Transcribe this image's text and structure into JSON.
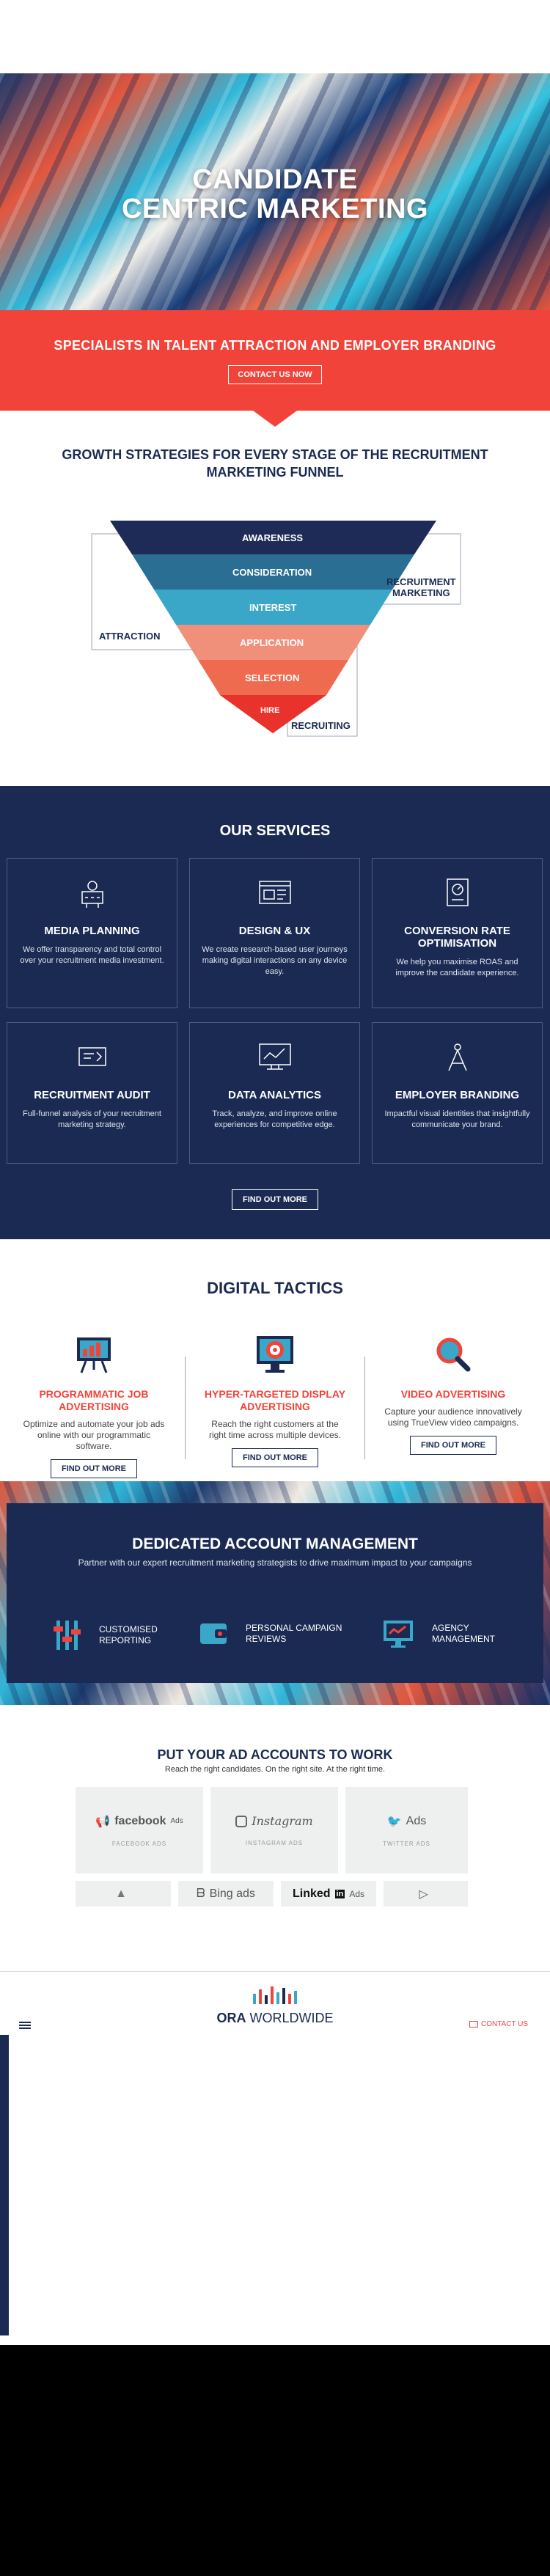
{
  "hero": {
    "title_line1": "CANDIDATE",
    "title_line2": "CENTRIC MARKETING"
  },
  "banner": {
    "headline": "SPECIALISTS IN TALENT ATTRACTION AND EMPLOYER BRANDING",
    "cta": "CONTACT US NOW"
  },
  "funnel": {
    "heading": "GROWTH STRATEGIES FOR EVERY STAGE OF THE RECRUITMENT MARKETING FUNNEL",
    "stages": [
      "AWARENESS",
      "CONSIDERATION",
      "INTEREST",
      "APPLICATION",
      "SELECTION",
      "HIRE"
    ],
    "side_labels": {
      "attraction": "ATTRACTION",
      "recruitment_marketing_1": "RECRUITMENT",
      "recruitment_marketing_2": "MARKETING",
      "recruiting": "RECRUITING"
    },
    "colors": [
      "#1d2b56",
      "#2a6f93",
      "#3aa7c8",
      "#f0907a",
      "#ef6b50",
      "#e8322b"
    ]
  },
  "services": {
    "heading": "OUR SERVICES",
    "items": [
      {
        "title": "MEDIA PLANNING",
        "text": "We offer transparency and total control over your recruitment media investment.",
        "icon": "media-planning-icon"
      },
      {
        "title": "DESIGN & UX",
        "text": "We create research-based user journeys making digital interactions on any device easy.",
        "icon": "design-ux-icon"
      },
      {
        "title": "CONVERSION RATE OPTIMISATION",
        "text": "We help you maximise ROAS and improve the candidate experience.",
        "icon": "conversion-icon"
      },
      {
        "title": "RECRUITMENT AUDIT",
        "text": "Full-funnel analysis of your recruitment marketing strategy.",
        "icon": "audit-icon"
      },
      {
        "title": "DATA ANALYTICS",
        "text": "Track, analyze, and improve online experiences for competitive edge.",
        "icon": "analytics-icon"
      },
      {
        "title": "EMPLOYER BRANDING",
        "text": "Impactful visual identities that insightfully communicate your brand.",
        "icon": "branding-icon"
      }
    ],
    "cta": "FIND OUT MORE"
  },
  "tactics": {
    "heading": "DIGITAL TACTICS",
    "items": [
      {
        "title": "PROGRAMMATIC JOB ADVERTISING",
        "text": "Optimize and automate your job ads online with our programmatic software.",
        "cta": "FIND OUT MORE",
        "icon": "easel-chart-icon"
      },
      {
        "title": "HYPER-TARGETED DISPLAY ADVERTISING",
        "text": "Reach the right customers at the right time across multiple devices.",
        "cta": "FIND OUT MORE",
        "icon": "target-monitor-icon"
      },
      {
        "title": "VIDEO ADVERTISING",
        "text": "Capture your audience innovatively using TrueView video campaigns.",
        "cta": "FIND OUT MORE",
        "icon": "magnifier-icon"
      }
    ]
  },
  "account": {
    "heading": "DEDICATED ACCOUNT MANAGEMENT",
    "subheading": "Partner with our expert recruitment marketing strategists to drive maximum impact to your campaigns",
    "features": [
      {
        "line1": "CUSTOMISED",
        "line2": "REPORTING",
        "icon": "sliders-icon"
      },
      {
        "line1": "PERSONAL CAMPAIGN",
        "line2": "REVIEWS",
        "icon": "wallet-icon"
      },
      {
        "line1": "AGENCY",
        "line2": "MANAGEMENT",
        "icon": "monitor-icon"
      }
    ]
  },
  "ads": {
    "heading": "PUT YOUR AD ACCOUNTS TO WORK",
    "subheading": "Reach the right candidates. On the right site. At the right time.",
    "tiles": [
      {
        "logo": "facebook",
        "suffix": "Ads",
        "caption": "FACEBOOK ADS"
      },
      {
        "logo": "Instagram",
        "suffix": "",
        "caption": "INSTAGRAM ADS"
      },
      {
        "logo": "Ads",
        "suffix": "",
        "caption": "TWITTER ADS"
      },
      {
        "logo": "",
        "suffix": "",
        "caption": ""
      },
      {
        "logo": "Bing ads",
        "suffix": "",
        "caption": ""
      },
      {
        "logo": "Linked",
        "suffix": "Ads",
        "caption": ""
      },
      {
        "logo": "",
        "suffix": "",
        "caption": ""
      }
    ]
  },
  "nav": {
    "brand_bold": "ORA",
    "brand_light": "WORLDWIDE",
    "contact": "CONTACT US"
  }
}
